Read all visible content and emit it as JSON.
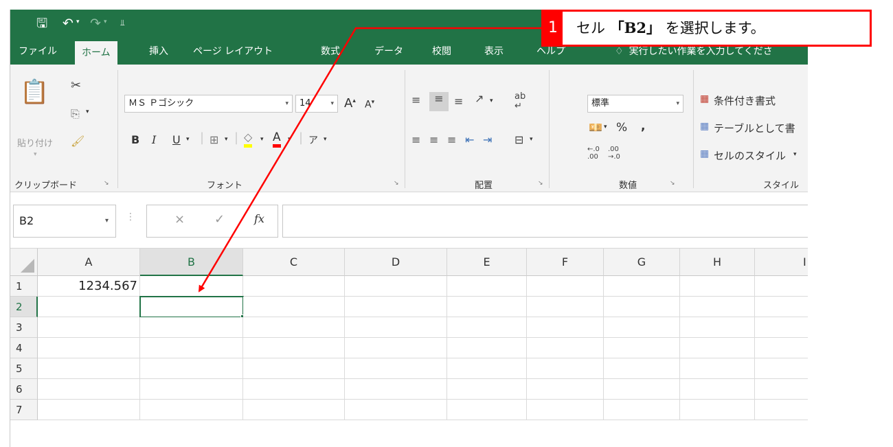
{
  "titlebar": {
    "save_icon": "save-icon",
    "undo_icon": "undo-icon",
    "redo_icon": "redo-icon",
    "customize_icon": "customize-qat-icon",
    "accent_color": "#217346"
  },
  "tabs": [
    {
      "label": "ファイル"
    },
    {
      "label": "ホーム"
    },
    {
      "label": "挿入"
    },
    {
      "label": "ページ レイアウト"
    },
    {
      "label": "数式"
    },
    {
      "label": "データ"
    },
    {
      "label": "校閲"
    },
    {
      "label": "表示"
    },
    {
      "label": "ヘルプ"
    }
  ],
  "tellme": {
    "text": "実行したい作業を入力してくださ",
    "icon": "lightbulb-icon"
  },
  "ribbon": {
    "clipboard": {
      "paste_label": "貼り付け",
      "group_label": "クリップボード"
    },
    "font": {
      "font_name": "ＭＳ Ｐゴシック",
      "font_size": "14",
      "bold": "B",
      "italic": "I",
      "underline": "U",
      "font_color_letter": "A",
      "grow_letter": "A",
      "shrink_letter": "A",
      "group_label": "フォント"
    },
    "alignment": {
      "group_label": "配置"
    },
    "number": {
      "format": "標準",
      "percent": "%",
      "comma": ",",
      "group_label": "数値"
    },
    "styles": {
      "conditional": "条件付き書式",
      "as_table": "テーブルとして書",
      "cell_styles": "セルのスタイル",
      "group_label": "スタイル"
    }
  },
  "formula_bar": {
    "name_box": "B2",
    "cancel_glyph": "×",
    "enter_glyph": "✓",
    "fx_label": "fx",
    "formula": ""
  },
  "sheet": {
    "columns": [
      "A",
      "B",
      "C",
      "D",
      "E",
      "F",
      "G",
      "H",
      "I"
    ],
    "rows": [
      "1",
      "2",
      "3",
      "4",
      "5",
      "6",
      "7"
    ],
    "cells": {
      "A1": "1234.567"
    },
    "active_cell": "B2"
  },
  "callout": {
    "step": "1",
    "prefix": "セル",
    "ref": "「B2」",
    "suffix": "を選択します。",
    "color": "#ff0000"
  }
}
